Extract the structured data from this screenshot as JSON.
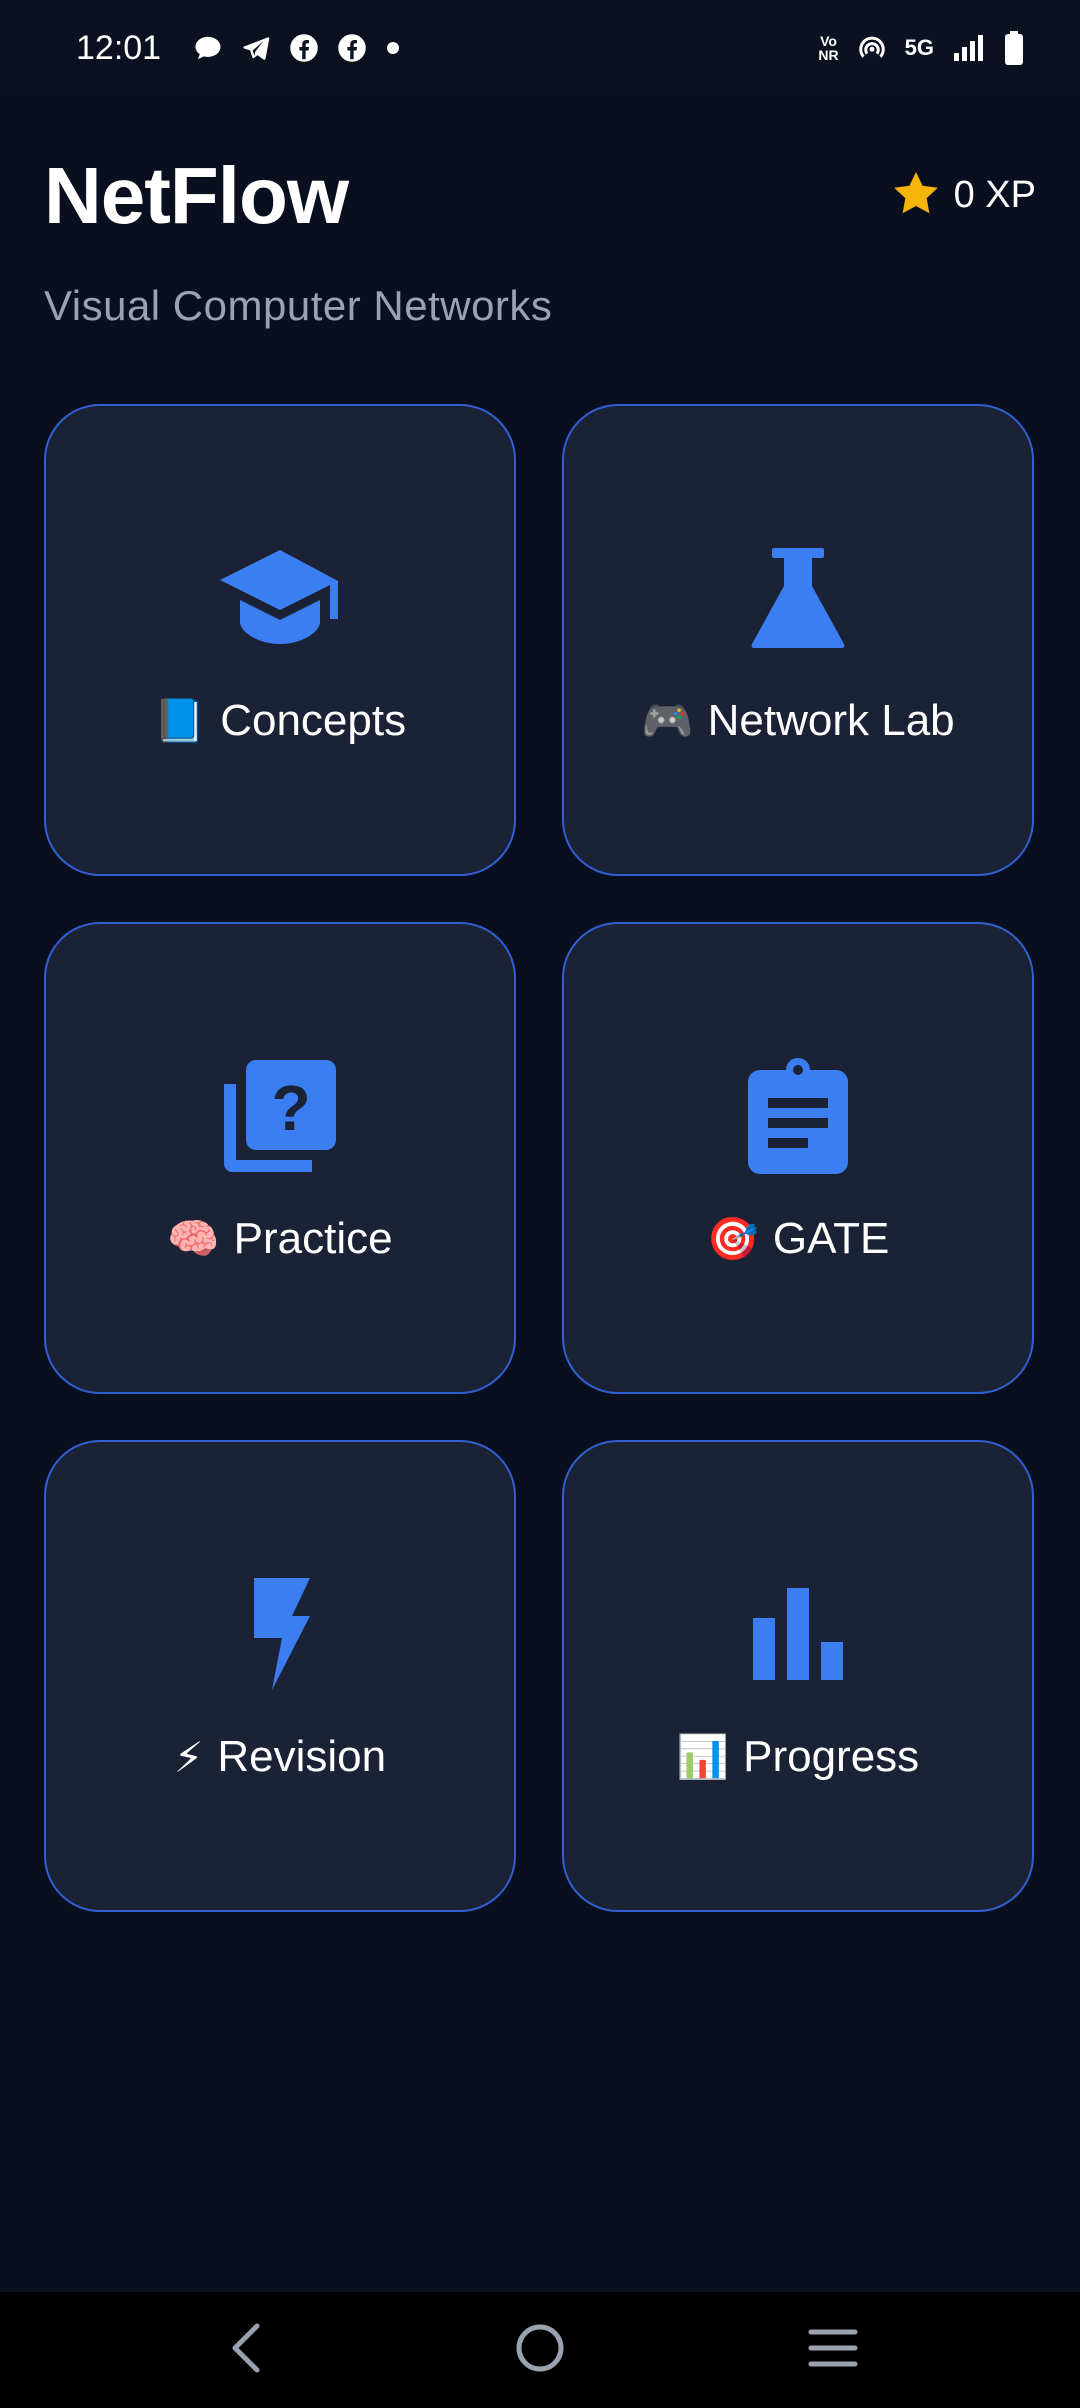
{
  "status_bar": {
    "time": "12:01",
    "icons_left": [
      "chat-bubble-icon",
      "telegram-icon",
      "facebook-icon",
      "facebook-icon",
      "dot-icon"
    ],
    "network": "5G",
    "volte_top": "Vo",
    "volte_bottom": "NR"
  },
  "header": {
    "title": "NetFlow",
    "subtitle": "Visual Computer Networks",
    "xp": "0 XP"
  },
  "colors": {
    "background": "#0a0f1f",
    "card": "#1c2236",
    "card_border": "#2f5fd0",
    "accent_blue": "#3b7ef2",
    "star": "#f5b50a",
    "subtitle": "#9aa1b0"
  },
  "cards": [
    {
      "label": "Concepts",
      "emoji": "📘",
      "icon": "graduation-cap-icon"
    },
    {
      "label": "Network Lab",
      "emoji": "🎮",
      "icon": "flask-icon"
    },
    {
      "label": "Practice",
      "emoji": "🧠",
      "icon": "quiz-icon"
    },
    {
      "label": "GATE",
      "emoji": "🎯",
      "icon": "clipboard-icon"
    },
    {
      "label": "Revision",
      "emoji": "⚡",
      "icon": "bolt-icon"
    },
    {
      "label": "Progress",
      "emoji": "📊",
      "icon": "bar-chart-icon"
    }
  ],
  "nav": [
    "back-icon",
    "home-icon",
    "menu-icon"
  ]
}
